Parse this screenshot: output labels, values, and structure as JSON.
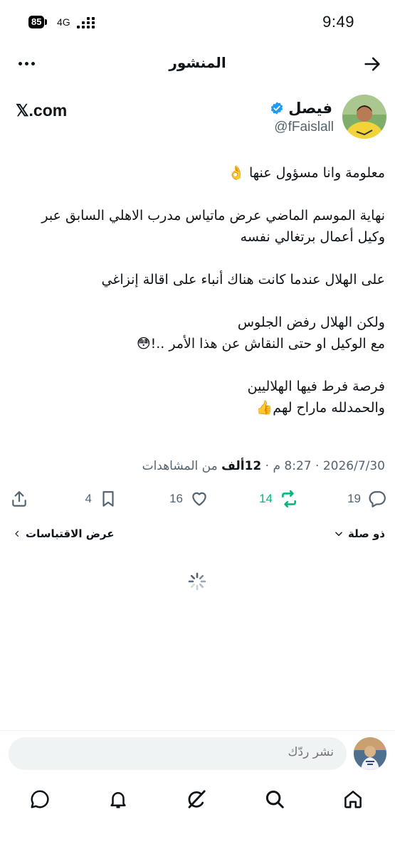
{
  "status_bar": {
    "battery": "85",
    "network": "4G",
    "time": "9:49"
  },
  "header": {
    "title": "المنشور",
    "icons": {
      "back": "arrow-right-icon",
      "more": "more-icon"
    }
  },
  "author": {
    "name": "فيصل",
    "handle": "@fFaislall",
    "verified": true,
    "watermark": "𝕏.com"
  },
  "tweet": {
    "paragraphs": [
      [
        "معلومة وانا مسؤول عنها 👌"
      ],
      [
        "نهاية الموسم الماضي عرض ماتياس مدرب الاهلي السابق عبر",
        "وكيل أعمال برتغالي نفسه"
      ],
      [
        "على الهلال عندما كانت هناك أنباء على اقالة إنزاغي"
      ],
      [
        "ولكن الهلال رفض الجلوس",
        "مع الوكيل او حتى النقاش عن هذا الأمر ..!😳"
      ],
      [
        "فرصة فرط فيها الهلاليين",
        "والحمدلله ماراح لهم👍"
      ]
    ]
  },
  "meta": {
    "date": "2026/7/30",
    "time": "8:27 م",
    "views_count": "12ألف",
    "views_label": "من المشاهدات",
    "separator": "·"
  },
  "actions": {
    "replies": "19",
    "reposts": "14",
    "likes": "16",
    "bookmarks": "4",
    "repost_color": "#00ba7c"
  },
  "sub_row": {
    "collab_label": "ذو صلة",
    "quotes_label": "عرض الاقتباسات"
  },
  "reply": {
    "placeholder": "نشر ردّك"
  },
  "bottom_nav": [
    "home-icon",
    "search-icon",
    "grok-icon",
    "notifications-icon",
    "messages-icon"
  ],
  "colors": {
    "text": "#0f1419",
    "secondary": "#536471",
    "verified": "#1d9bf0",
    "repost_active": "#00ba7c"
  }
}
